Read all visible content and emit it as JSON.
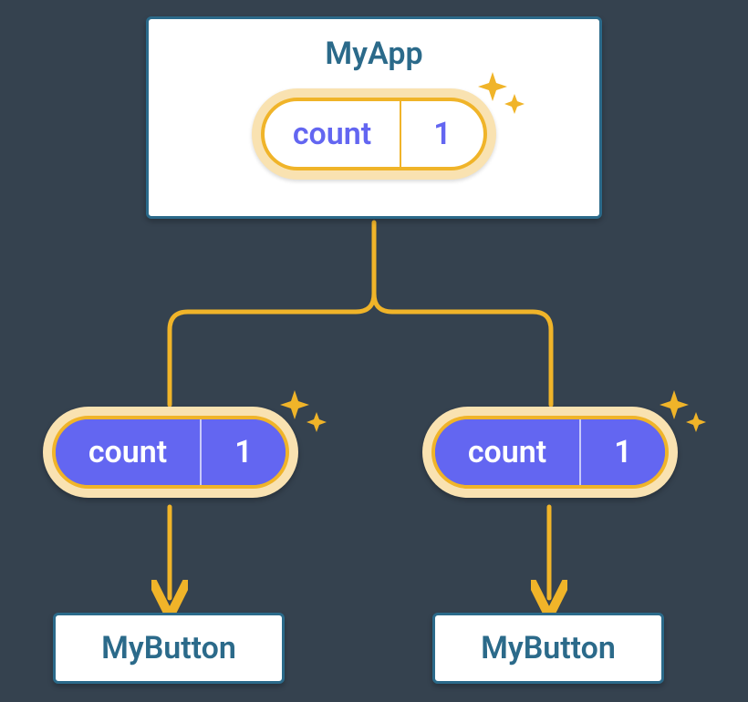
{
  "myapp": {
    "title": "MyApp",
    "state_label": "count",
    "state_value": "1"
  },
  "left": {
    "prop_label": "count",
    "prop_value": "1",
    "button_title": "MyButton"
  },
  "right": {
    "prop_label": "count",
    "prop_value": "1",
    "button_title": "MyButton"
  },
  "colors": {
    "node_border": "#2b6a8a",
    "edge": "#f0b429",
    "accent_fill": "#6366f1",
    "glow": "#f9e2b1"
  }
}
